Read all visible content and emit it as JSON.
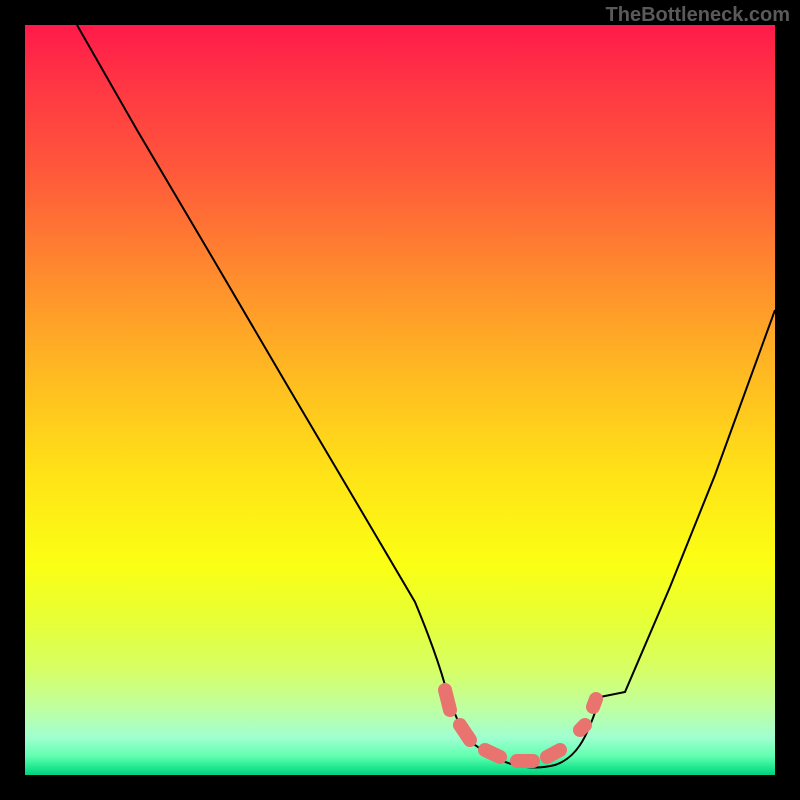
{
  "watermark": "TheBottleneck.com",
  "chart_data": {
    "type": "line",
    "title": "",
    "xlabel": "",
    "ylabel": "",
    "xlim": [
      0,
      100
    ],
    "ylim": [
      0,
      100
    ],
    "series": [
      {
        "name": "bottleneck-curve",
        "x": [
          7,
          15,
          25,
          35,
          45,
          52,
          56,
          60,
          64,
          68,
          72,
          75,
          80,
          86,
          92,
          100
        ],
        "y": [
          100,
          86,
          69,
          52,
          35,
          23,
          12,
          4,
          1,
          0.5,
          1,
          3,
          11,
          25,
          40,
          62
        ]
      }
    ],
    "annotations": [
      {
        "name": "valley-highlight",
        "x_range": [
          56,
          76
        ],
        "y": 3
      }
    ],
    "colors": {
      "curve": "#000000",
      "highlight": "#e8736f",
      "gradient_top": "#ff1a4a",
      "gradient_bottom": "#00d080"
    }
  }
}
